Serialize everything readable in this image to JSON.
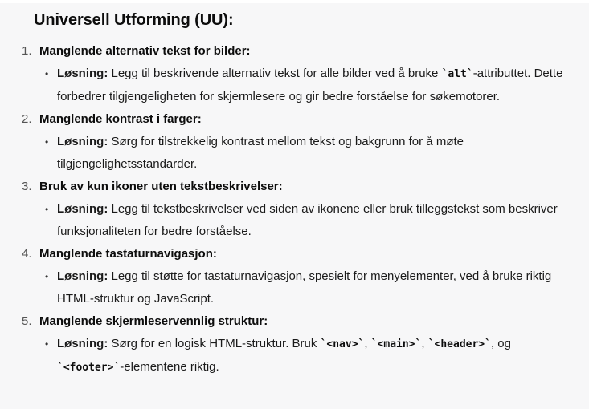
{
  "heading": "Universell Utforming (UU):",
  "solution_label": "Løsning:",
  "issues": [
    {
      "number": "1.",
      "title": "Manglende alternativ tekst for bilder:",
      "text_before": " Legg til beskrivende alternativ tekst for alle bilder ved å bruke ",
      "code": "`alt`",
      "text_after": "-attributtet. Dette forbedrer tilgjengeligheten for skjermlesere og gir bedre forståelse for søkemotorer."
    },
    {
      "number": "2.",
      "title": "Manglende kontrast i farger:",
      "text": " Sørg for tilstrekkelig kontrast mellom tekst og bakgrunn for å møte tilgjengelighetsstandarder."
    },
    {
      "number": "3.",
      "title": "Bruk av kun ikoner uten tekstbeskrivelser:",
      "text": " Legg til tekstbeskrivelser ved siden av ikonene eller bruk tilleggstekst som beskriver funksjonaliteten for bedre forståelse."
    },
    {
      "number": "4.",
      "title": "Manglende tastaturnavigasjon:",
      "text": " Legg til støtte for tastaturnavigasjon, spesielt for menyelementer, ved å bruke riktig HTML-struktur og JavaScript."
    },
    {
      "number": "5.",
      "title": "Manglende skjermleservennlig struktur:",
      "text_before": " Sørg for en logisk HTML-struktur. Bruk ",
      "code_nav": "`<nav>`",
      "sep1": ", ",
      "code_main": "`<main>`",
      "sep2": ", ",
      "code_header": "`<header>`",
      "sep3": ", og ",
      "code_footer": "`<footer>`",
      "text_after": "-elementene riktig."
    }
  ]
}
